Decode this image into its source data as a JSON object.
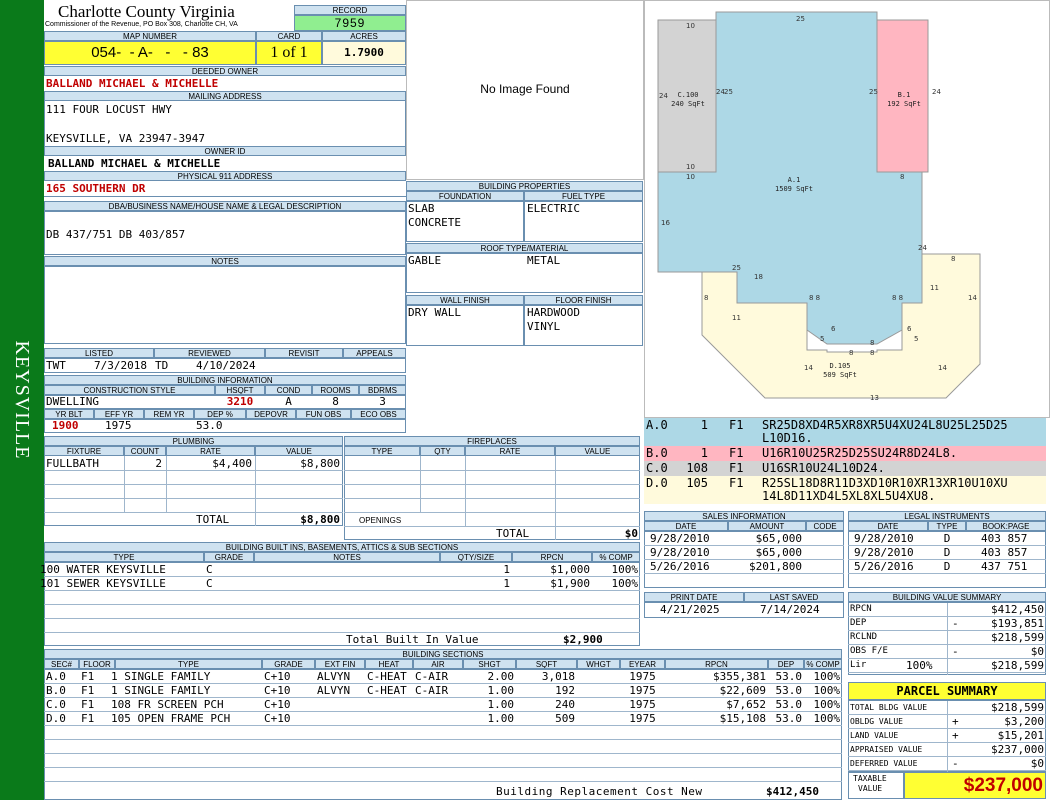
{
  "sidebar": {
    "text": "KEYSVILLE",
    "color": "#0a7a1a"
  },
  "header": {
    "county": "Charlotte County Virginia",
    "commissioner": "Commissioner of the Revenue, PO Box 308, Charlotte CH, VA",
    "record_label": "RECORD",
    "record": "7959",
    "map_label": "MAP NUMBER",
    "map_number": "054-  - A-   -   - 83",
    "card_label": "CARD",
    "card": "1 of 1",
    "acres_label": "ACRES",
    "acres": "1.7900"
  },
  "owner": {
    "deeded_label": "DEEDED OWNER",
    "deeded": "BALLAND MICHAEL & MICHELLE",
    "mailing_label": "MAILING ADDRESS",
    "address1": "111 FOUR LOCUST HWY",
    "address2": "KEYSVILLE, VA 23947-3947",
    "ownerid_label": "OWNER ID",
    "ownerid": "BALLAND MICHAEL & MICHELLE",
    "e911_label": "PHYSICAL 911 ADDRESS",
    "e911": "165 SOUTHERN DR",
    "legal_label": "DBA/BUSINESS NAME/HOUSE NAME & LEGAL DESCRIPTION",
    "legal": "DB 437/751 DB 403/857",
    "notes_label": "NOTES"
  },
  "image_placeholder": "No Image Found",
  "building_properties": {
    "title": "BUILDING PROPERTIES",
    "foundation_label": "FOUNDATION",
    "fuel_label": "FUEL TYPE",
    "foundation": [
      "SLAB",
      "CONCRETE"
    ],
    "fuel": [
      "ELECTRIC"
    ],
    "roof_label": "ROOF TYPE/MATERIAL",
    "roof": [
      "GABLE",
      "METAL"
    ],
    "wall_label": "WALL FINISH",
    "floor_label": "FLOOR FINISH",
    "wall": [
      "DRY WALL"
    ],
    "floor": [
      "HARDWOOD",
      "VINYL"
    ]
  },
  "review": {
    "listed_label": "LISTED",
    "reviewed_label": "REVIEWED",
    "revisit_label": "REVISIT",
    "appeals_label": "APPEALS",
    "listed_by": "TWT",
    "listed_date": "7/3/2018",
    "reviewed_by": "TD",
    "reviewed_date": "4/10/2024"
  },
  "building_info": {
    "title": "BUILDING INFORMATION",
    "style_label": "CONSTRUCTION STYLE",
    "hsqft_label": "HSQFT",
    "cond_label": "COND",
    "rooms_label": "ROOMS",
    "bdrms_label": "BDRMS",
    "style": "DWELLING",
    "hsqft": "3210",
    "cond": "A",
    "rooms": "8",
    "bdrms": "3",
    "yrblt_label": "YR BLT",
    "effyr_label": "EFF YR",
    "remyr_label": "REM YR",
    "dep_label": "DEP %",
    "depovr_label": "DEPOVR",
    "funobs_label": "FUN OBS",
    "ecoobs_label": "ECO OBS",
    "yrblt": "1900",
    "effyr": "1975",
    "dep": "53.0"
  },
  "plumbing": {
    "title": "PLUMBING",
    "headers": [
      "FIXTURE",
      "COUNT",
      "RATE",
      "VALUE"
    ],
    "rows": [
      [
        "FULLBATH",
        "2",
        "$4,400",
        "$8,800"
      ]
    ],
    "total_label": "TOTAL",
    "total": "$8,800"
  },
  "fireplaces": {
    "title": "FIREPLACES",
    "headers": [
      "TYPE",
      "QTY",
      "RATE",
      "VALUE"
    ],
    "openings_label": "OPENINGS",
    "total_label": "TOTAL",
    "total": "$0"
  },
  "built_ins": {
    "title": "BUILDING BUILT INS, BASEMENTS, ATTICS & SUB SECTIONS",
    "headers": [
      "TYPE",
      "GRADE",
      "NOTES",
      "QTY/SIZE",
      "RPCN",
      "% COMP"
    ],
    "rows": [
      [
        "100 WATER KEYSVILLE",
        "C",
        "",
        "1",
        "$1,000",
        "100%"
      ],
      [
        "101 SEWER KEYSVILLE",
        "C",
        "",
        "1",
        "$1,900",
        "100%"
      ]
    ],
    "total_label": "Total Built In Value",
    "total": "$2,900"
  },
  "sections": {
    "title": "BUILDING SECTIONS",
    "headers": [
      "SEC#",
      "FLOOR",
      "TYPE",
      "GRADE",
      "EXT FIN",
      "HEAT",
      "AIR",
      "SHGT",
      "SQFT",
      "WHGT",
      "EYEAR",
      "RPCN",
      "DEP",
      "% COMP"
    ],
    "rows": [
      [
        "A.0",
        "F1",
        "1 SINGLE FAMILY",
        "C+10",
        "ALVYN",
        "C-HEAT",
        "C-AIR",
        "2.00",
        "3,018",
        "",
        "1975",
        "$355,381",
        "53.0",
        "100%"
      ],
      [
        "B.0",
        "F1",
        "1 SINGLE FAMILY",
        "C+10",
        "ALVYN",
        "C-HEAT",
        "C-AIR",
        "1.00",
        "192",
        "",
        "1975",
        "$22,609",
        "53.0",
        "100%"
      ],
      [
        "C.0",
        "F1",
        "108 FR SCREEN PCH",
        "C+10",
        "",
        "",
        "",
        "1.00",
        "240",
        "",
        "1975",
        "$7,652",
        "53.0",
        "100%"
      ],
      [
        "D.0",
        "F1",
        "105 OPEN FRAME PCH",
        "C+10",
        "",
        "",
        "",
        "1.00",
        "509",
        "",
        "1975",
        "$15,108",
        "53.0",
        "100%"
      ]
    ],
    "rcn_label": "Building Replacement Cost New",
    "rcn": "$412,450"
  },
  "sketch": {
    "labels": [
      {
        "name": "C.100",
        "area": "240 SqFt"
      },
      {
        "name": "B.1",
        "area": "192 SqFt"
      },
      {
        "name": "A.1",
        "area": "1509 SqFt"
      },
      {
        "name": "D.105",
        "area": "509 SqFt"
      }
    ],
    "colors": {
      "A": "#add8e6",
      "B": "#ffb6c1",
      "C": "#d3d3d3",
      "D": "#fffadc"
    }
  },
  "vectors": [
    {
      "sec": "A.0",
      "code": "1",
      "floor": "F1",
      "vec": "SR25D8XD4R5XR8XR5U4XU24L8U25L25D25",
      "vec2": "L10D16.",
      "color": "#add8e6"
    },
    {
      "sec": "B.0",
      "code": "1",
      "floor": "F1",
      "vec": "U16R10U25R25D25SU24R8D24L8.",
      "vec2": "",
      "color": "#ffb6c1"
    },
    {
      "sec": "C.0",
      "code": "108",
      "floor": "F1",
      "vec": "U16SR10U24L10D24.",
      "vec2": "",
      "color": "#d3d3d3"
    },
    {
      "sec": "D.0",
      "code": "105",
      "floor": "F1",
      "vec": "R25SL18D8R11D3XD10R10XR13XR10U10XU",
      "vec2": "14L8D11XD4L5XL8XL5U4XU8.",
      "color": "#fffadc"
    }
  ],
  "sales": {
    "title": "SALES INFORMATION",
    "headers": [
      "DATE",
      "AMOUNT",
      "CODE"
    ],
    "rows": [
      [
        "9/28/2010",
        "$65,000",
        ""
      ],
      [
        "9/28/2010",
        "$65,000",
        ""
      ],
      [
        "5/26/2016",
        "$201,800",
        ""
      ]
    ]
  },
  "legal_instruments": {
    "title": "LEGAL INSTRUMENTS",
    "headers": [
      "DATE",
      "TYPE",
      "BOOK:PAGE"
    ],
    "rows": [
      [
        "9/28/2010",
        "D",
        "403 857"
      ],
      [
        "9/28/2010",
        "D",
        "403 857"
      ],
      [
        "5/26/2016",
        "D",
        "437 751"
      ]
    ]
  },
  "print": {
    "print_label": "PRINT DATE",
    "saved_label": "LAST SAVED",
    "print_date": "4/21/2025",
    "last_saved": "7/14/2024"
  },
  "value_summary": {
    "title": "BUILDING VALUE SUMMARY",
    "rows": [
      {
        "label": "RPCN",
        "sign": "",
        "value": "$412,450"
      },
      {
        "label": "DEP",
        "sign": "-",
        "value": "$193,851"
      },
      {
        "label": "RCLND",
        "sign": "",
        "value": "$218,599"
      },
      {
        "label": "OBS F/E",
        "sign": "-",
        "value": "$0"
      },
      {
        "label": "Lir",
        "sign": "100%",
        "value": "$218,599"
      }
    ]
  },
  "parcel": {
    "title": "PARCEL SUMMARY",
    "rows": [
      {
        "label": "TOTAL BLDG VALUE",
        "sign": "",
        "value": "$218,599"
      },
      {
        "label": "OBLDG VALUE",
        "sign": "+",
        "value": "$3,200"
      },
      {
        "label": "LAND VALUE",
        "sign": "+",
        "value": "$15,201"
      },
      {
        "label": "APPRAISED VALUE",
        "sign": "",
        "value": "$237,000"
      },
      {
        "label": "DEFERRED VALUE",
        "sign": "-",
        "value": "$0"
      }
    ],
    "taxable_label1": "TAXABLE",
    "taxable_label2": "VALUE",
    "taxable": "$237,000"
  }
}
